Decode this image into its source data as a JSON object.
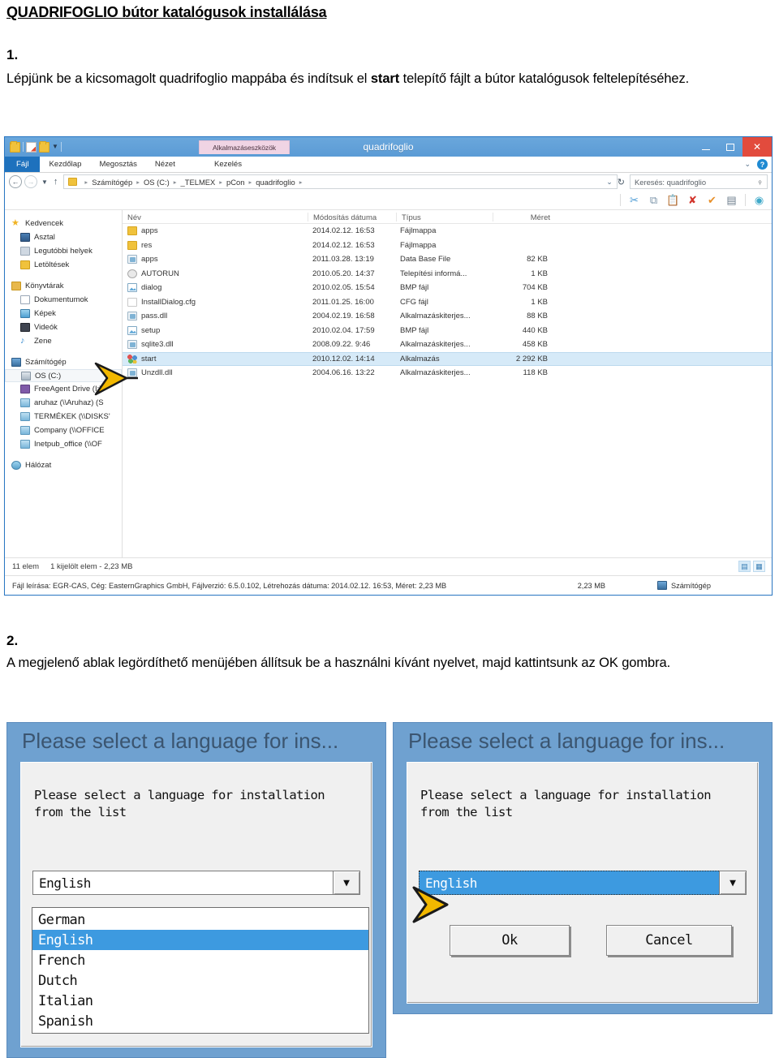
{
  "document": {
    "title": "QUADRIFOGLIO bútor katalógusok installálása",
    "steps": [
      {
        "number": "1.",
        "text_before": "Lépjünk be a kicsomagolt quadrifoglio mappába és indítsuk el ",
        "bold": "start",
        "text_after": " telepítő fájlt a bútor katalógusok feltelepítéséhez."
      },
      {
        "number": "2.",
        "text": "A megjelenő ablak legördíthető menüjében állítsuk be a használni kívánt nyelvet, majd kattintsunk az OK gombra."
      }
    ]
  },
  "explorer": {
    "window_title": "quadrifoglio",
    "contextual_tab_band": "Alkalmazáseszközök",
    "ribbon_tabs": [
      "Fájl",
      "Kezdőlap",
      "Megosztás",
      "Nézet",
      "Kezelés"
    ],
    "quick_access_icons": [
      "folder-icon",
      "properties-icon",
      "new-folder-icon",
      "customize-caret-icon"
    ],
    "window_buttons": [
      "minimize-button",
      "maximize-button",
      "close-button"
    ],
    "help_icon": "help-icon",
    "ribbon_collapse_icon": "chevron-down-icon",
    "address": {
      "back_icon": "back-arrow-icon",
      "forward_icon": "forward-arrow-icon",
      "recent_icon": "chevron-down-icon",
      "up_icon": "up-arrow-icon",
      "breadcrumbs": [
        "Számítógép",
        "OS (C:)",
        "_TELMEX",
        "pCon",
        "quadrifoglio"
      ],
      "dropdown_icon": "chevron-down-icon",
      "refresh_icon": "refresh-icon",
      "search_placeholder": "Keresés: quadrifoglio",
      "search_icon": "search-icon"
    },
    "toolstrip_icons": [
      "cut-icon",
      "copy-icon",
      "paste-icon",
      "delete-icon",
      "check-icon",
      "rename-icon",
      "globe-icon"
    ],
    "nav_pane": {
      "groups": [
        {
          "header": {
            "label": "Kedvencek",
            "icon": "star-icon"
          },
          "items": [
            {
              "label": "Asztal",
              "icon": "desktop-icon"
            },
            {
              "label": "Legutóbbi helyek",
              "icon": "recent-places-icon"
            },
            {
              "label": "Letöltések",
              "icon": "downloads-icon"
            }
          ]
        },
        {
          "header": {
            "label": "Könyvtárak",
            "icon": "libraries-icon"
          },
          "items": [
            {
              "label": "Dokumentumok",
              "icon": "documents-icon"
            },
            {
              "label": "Képek",
              "icon": "pictures-icon"
            },
            {
              "label": "Videók",
              "icon": "videos-icon"
            },
            {
              "label": "Zene",
              "icon": "music-icon"
            }
          ]
        },
        {
          "header": {
            "label": "Számítógép",
            "icon": "computer-icon"
          },
          "items": [
            {
              "label": "OS (C:)",
              "icon": "drive-icon",
              "selected": true
            },
            {
              "label": "FreeAgent Drive (I:)",
              "icon": "external-drive-icon"
            },
            {
              "label": "aruhaz (\\\\Aruhaz) (S",
              "icon": "network-drive-icon"
            },
            {
              "label": "TERMÉKEK (\\\\DISKS'",
              "icon": "network-drive-icon"
            },
            {
              "label": "Company (\\\\OFFICE",
              "icon": "network-drive-icon"
            },
            {
              "label": "Inetpub_office (\\\\OF",
              "icon": "network-drive-icon"
            }
          ]
        },
        {
          "header": {
            "label": "Hálózat",
            "icon": "network-icon"
          },
          "items": []
        }
      ]
    },
    "file_list": {
      "columns": [
        "Név",
        "Módosítás dátuma",
        "Típus",
        "Méret"
      ],
      "rows": [
        {
          "name": "apps",
          "icon": "folder-icon",
          "date": "2014.02.12. 16:53",
          "type": "Fájlmappa",
          "size": ""
        },
        {
          "name": "res",
          "icon": "folder-icon",
          "date": "2014.02.12. 16:53",
          "type": "Fájlmappa",
          "size": ""
        },
        {
          "name": "apps",
          "icon": "database-icon",
          "date": "2011.03.28. 13:19",
          "type": "Data Base File",
          "size": "82 KB"
        },
        {
          "name": "AUTORUN",
          "icon": "inf-icon",
          "date": "2010.05.20. 14:37",
          "type": "Telepítési informá...",
          "size": "1 KB"
        },
        {
          "name": "dialog",
          "icon": "bitmap-icon",
          "date": "2010.02.05. 15:54",
          "type": "BMP fájl",
          "size": "704 KB"
        },
        {
          "name": "InstallDialog.cfg",
          "icon": "cfg-icon",
          "date": "2011.01.25. 16:00",
          "type": "CFG fájl",
          "size": "1 KB"
        },
        {
          "name": "pass.dll",
          "icon": "database-icon",
          "date": "2004.02.19. 16:58",
          "type": "Alkalmazáskiterjes...",
          "size": "88 KB"
        },
        {
          "name": "setup",
          "icon": "bitmap-icon",
          "date": "2010.02.04. 17:59",
          "type": "BMP fájl",
          "size": "440 KB"
        },
        {
          "name": "sqlite3.dll",
          "icon": "database-icon",
          "date": "2008.09.22. 9:46",
          "type": "Alkalmazáskiterjes...",
          "size": "458 KB"
        },
        {
          "name": "start",
          "icon": "application-icon",
          "date": "2010.12.02. 14:14",
          "type": "Alkalmazás",
          "size": "2 292 KB",
          "selected": true
        },
        {
          "name": "Unzdll.dll",
          "icon": "database-icon",
          "date": "2004.06.16. 13:22",
          "type": "Alkalmazáskiterjes...",
          "size": "118 KB"
        }
      ]
    },
    "status": {
      "item_count": "11 elem",
      "selection": "1 kijelölt elem - 2,23 MB",
      "details": "Fájl leírása: EGR-CAS, Cég: EasternGraphics GmbH, Fájlverzió: 6.5.0.102, Létrehozás dátuma: 2014.02.12. 16:53, Méret: 2,23 MB",
      "size": "2,23 MB",
      "location": "Számítógép",
      "location_icon": "computer-icon",
      "view_details_icon": "details-view-icon",
      "view_large_icon": "large-icons-view-icon"
    }
  },
  "dialogs": {
    "left": {
      "title": "Please select a language for ins...",
      "message": "Please select a language for installation\nfrom the list",
      "combo_value": "English",
      "combo_caret_icon": "chevron-down-icon",
      "dropdown_open": true,
      "dropdown_options": [
        "German",
        "English",
        "French",
        "Dutch",
        "Italian",
        "Spanish"
      ],
      "dropdown_selected": "English"
    },
    "right": {
      "title": "Please select a language for ins...",
      "message": "Please select a language for installation\nfrom the list",
      "combo_value": "English",
      "combo_caret_icon": "chevron-down-icon",
      "combo_focused": true,
      "buttons": [
        "Ok",
        "Cancel"
      ]
    }
  },
  "annotations": {
    "arrow_icon": "yellow-arrow-pointer",
    "color": "#f2b800"
  }
}
